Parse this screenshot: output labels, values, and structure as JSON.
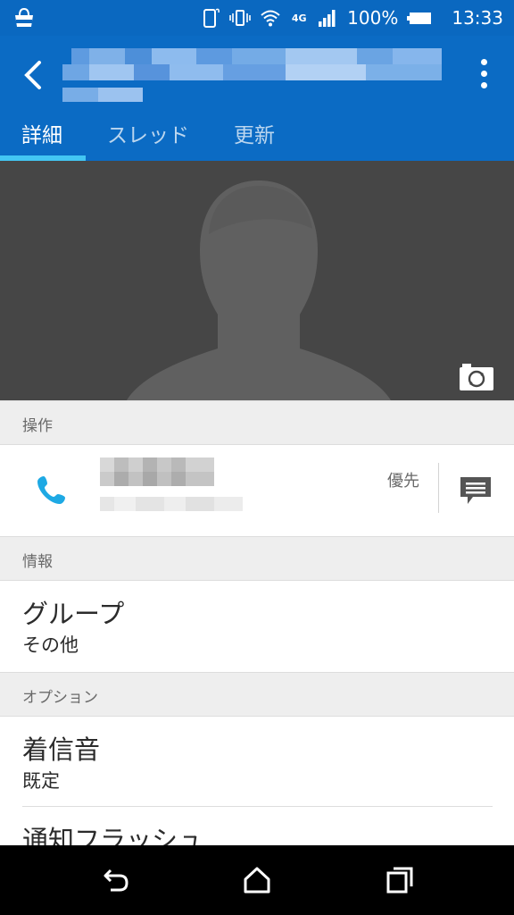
{
  "status_bar": {
    "battery_percent": "100%",
    "time": "13:33",
    "network": "4G",
    "icons": [
      "market-bag-icon",
      "phone-vibrate-icon",
      "vibrate-icon",
      "wifi-icon",
      "signal-icon",
      "battery-icon"
    ]
  },
  "app_bar": {
    "title": "",
    "tabs": [
      {
        "label": "詳細",
        "active": true
      },
      {
        "label": "スレッド",
        "active": false
      },
      {
        "label": "更新",
        "active": false
      }
    ]
  },
  "sections": {
    "actions": {
      "header": "操作",
      "priority_label": "優先"
    },
    "info": {
      "header": "情報",
      "group_title": "グループ",
      "group_value": "その他"
    },
    "options": {
      "header": "オプション",
      "ringtone_title": "着信音",
      "ringtone_value": "既定",
      "flash_title": "通知フラッシュ"
    }
  },
  "colors": {
    "app_bar": "#0b6bc4",
    "tab_indicator": "#43c6f3",
    "phone_icon": "#1ea9e4",
    "photo_bg": "#464646"
  }
}
